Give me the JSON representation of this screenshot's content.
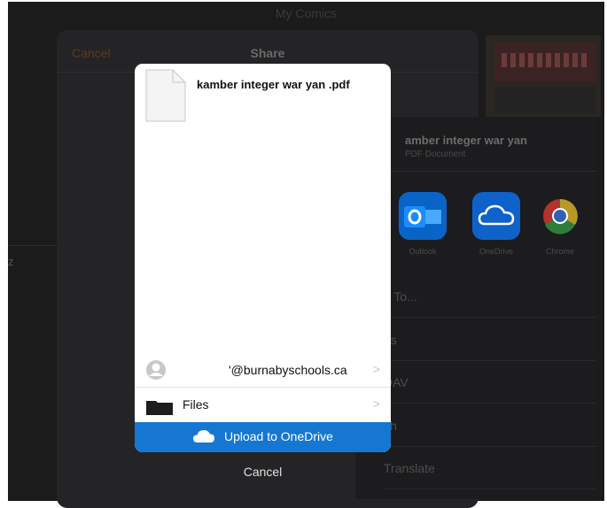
{
  "window": {
    "title": "My Comics"
  },
  "left_panel": {
    "text": "z"
  },
  "share_sheet": {
    "cancel_label": "Cancel",
    "title": "Share"
  },
  "actions_panel": {
    "file_name": "amber integer war yan",
    "file_type": "PDF Document",
    "apps": [
      {
        "label": "Outlook",
        "icon": "outlook-icon",
        "color": "#0a64c8"
      },
      {
        "label": "OneDrive",
        "icon": "onedrive-icon",
        "color": "#0f62c9"
      },
      {
        "label": "Chrome",
        "icon": "chrome-icon",
        "color": "#ffffff"
      }
    ],
    "rows": [
      "d To...",
      "es",
      "DAV",
      "ch",
      "Translate"
    ]
  },
  "picker": {
    "file_name": "kamber integer war yan .pdf",
    "account_label": "'@burnabyschools.ca",
    "files_label": "Files",
    "upload_label": "Upload to OneDrive",
    "chevron": ">"
  },
  "bottom": {
    "cancel_label": "Cancel"
  },
  "colors": {
    "upload_blue": "#1677d2",
    "share_cancel": "#5c3b1a"
  }
}
